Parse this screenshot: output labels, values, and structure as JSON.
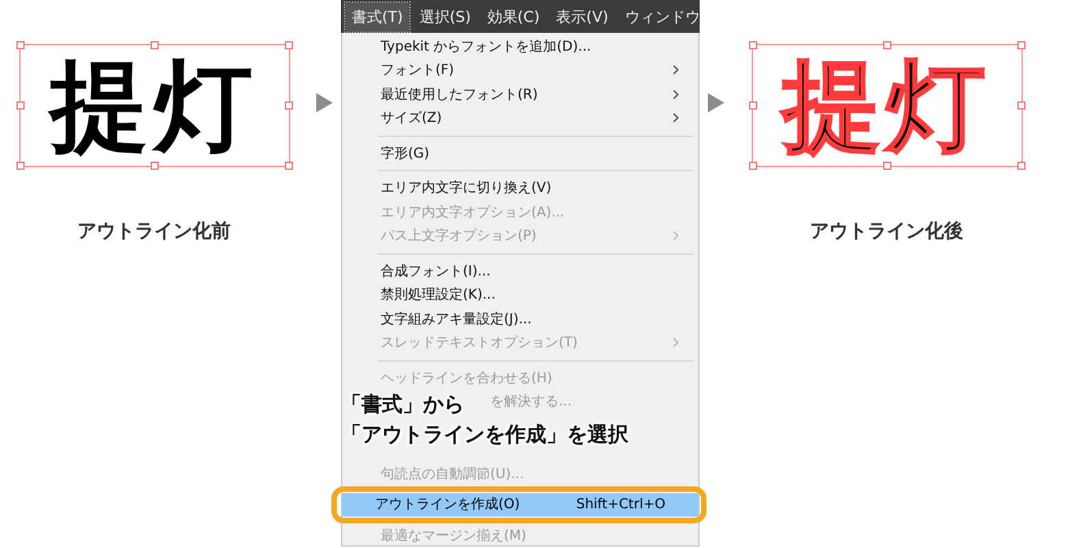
{
  "before": {
    "glyphs": "提灯",
    "label": "アウトライン化前",
    "outlined": false
  },
  "after": {
    "glyphs": "提灯",
    "label": "アウトライン化後",
    "outlined": true
  },
  "menubar": [
    {
      "label": "書式(T)",
      "selected": true
    },
    {
      "label": "選択(S)",
      "selected": false
    },
    {
      "label": "効果(C)",
      "selected": false
    },
    {
      "label": "表示(V)",
      "selected": false
    },
    {
      "label": "ウィンドウ",
      "selected": false
    }
  ],
  "menu": [
    {
      "kind": "item",
      "label": "Typekit からフォントを追加(D)...",
      "disabled": false,
      "submenu": false,
      "selected": false
    },
    {
      "kind": "item",
      "label": "フォント(F)",
      "disabled": false,
      "submenu": true,
      "selected": false
    },
    {
      "kind": "item",
      "label": "最近使用したフォント(R)",
      "disabled": false,
      "submenu": true,
      "selected": false
    },
    {
      "kind": "item",
      "label": "サイズ(Z)",
      "disabled": false,
      "submenu": true,
      "selected": false
    },
    {
      "kind": "separator"
    },
    {
      "kind": "item",
      "label": "字形(G)",
      "disabled": false,
      "submenu": false,
      "selected": false
    },
    {
      "kind": "separator"
    },
    {
      "kind": "item",
      "label": "エリア内文字に切り換え(V)",
      "disabled": false,
      "submenu": false,
      "selected": false
    },
    {
      "kind": "item",
      "label": "エリア内文字オプション(A)...",
      "disabled": true,
      "submenu": false,
      "selected": false
    },
    {
      "kind": "item",
      "label": "パス上文字オプション(P)",
      "disabled": true,
      "submenu": true,
      "selected": false
    },
    {
      "kind": "separator"
    },
    {
      "kind": "item",
      "label": "合成フォント(I)...",
      "disabled": false,
      "submenu": false,
      "selected": false
    },
    {
      "kind": "item",
      "label": "禁則処理設定(K)...",
      "disabled": false,
      "submenu": false,
      "selected": false
    },
    {
      "kind": "item",
      "label": "文字組みアキ量設定(J)...",
      "disabled": false,
      "submenu": false,
      "selected": false
    },
    {
      "kind": "item",
      "label": "スレッドテキストオプション(T)",
      "disabled": true,
      "submenu": true,
      "selected": false
    },
    {
      "kind": "separator"
    },
    {
      "kind": "item",
      "label": "ヘッドラインを合わせる(H)",
      "disabled": true,
      "submenu": false,
      "selected": false
    },
    {
      "kind": "partial",
      "label": "を解決する..."
    },
    {
      "kind": "blank"
    },
    {
      "kind": "blank"
    },
    {
      "kind": "item",
      "label": "句読点の自動調節(U)...",
      "disabled": true,
      "submenu": false,
      "selected": false
    },
    {
      "kind": "item",
      "label": "アウトラインを作成(O)",
      "shortcut": "Shift+Ctrl+O",
      "disabled": false,
      "submenu": false,
      "selected": true
    },
    {
      "kind": "item",
      "label": "最適なマージン揃え(M)",
      "disabled": true,
      "submenu": false,
      "selected": false
    }
  ],
  "caption": [
    "「書式」から",
    "「アウトラインを作成」を選択"
  ]
}
